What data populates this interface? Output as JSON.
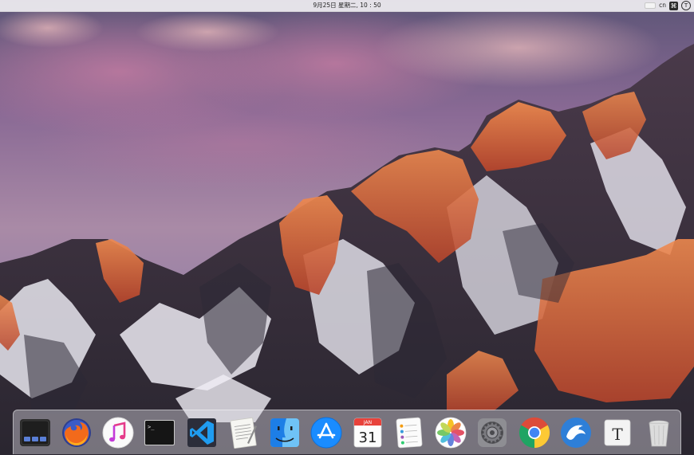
{
  "menubar": {
    "datetime": "9月25日 星期二, 10 : 50",
    "input_language": "cn",
    "ime_symbol": "⌘",
    "user_initial": "T"
  },
  "dock": {
    "items": [
      {
        "name": "Mission Control",
        "icon": "mission-control-icon"
      },
      {
        "name": "Firefox",
        "icon": "firefox-icon"
      },
      {
        "name": "iTunes",
        "icon": "itunes-icon"
      },
      {
        "name": "Terminal",
        "icon": "terminal-icon"
      },
      {
        "name": "Visual Studio Code",
        "icon": "vscode-icon"
      },
      {
        "name": "TextEdit",
        "icon": "textedit-icon"
      },
      {
        "name": "Finder",
        "icon": "finder-icon"
      },
      {
        "name": "App Store",
        "icon": "app-store-icon"
      },
      {
        "name": "Calendar",
        "icon": "calendar-icon"
      },
      {
        "name": "Reminders",
        "icon": "reminders-icon"
      },
      {
        "name": "Photos",
        "icon": "photos-icon"
      },
      {
        "name": "System Preferences",
        "icon": "system-preferences-icon"
      },
      {
        "name": "Google Chrome",
        "icon": "chrome-icon"
      },
      {
        "name": "Eagle",
        "icon": "eagle-icon"
      },
      {
        "name": "Typora",
        "icon": "typora-icon"
      },
      {
        "name": "Trash",
        "icon": "trash-icon"
      }
    ],
    "calendar": {
      "month": "JAN",
      "day": "31"
    },
    "terminal_prompt": ">_",
    "typora_letter": "T"
  },
  "colors": {
    "sky_top": "#6b5f8a",
    "sky_mid": "#9a7aa0",
    "mountain_glow": "#e06a3a",
    "accent_blue": "#1a8cff"
  }
}
